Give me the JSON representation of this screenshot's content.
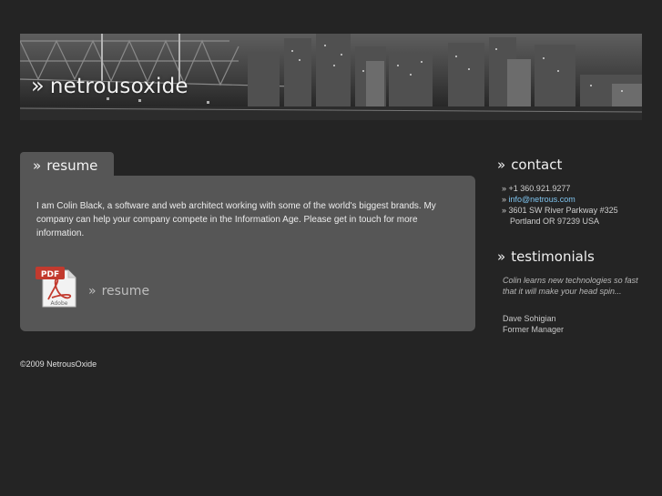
{
  "header": {
    "brand_arrow": "»",
    "brand": "netrousoxide"
  },
  "resume_panel": {
    "tab_arrow": "»",
    "tab_label": "resume",
    "intro": "I am Colin Black, a software and web architect working with some of the world's biggest brands. My company can help your company compete in the Information Age. Please get in touch for more information.",
    "pdf_badge": "PDF",
    "pdf_vendor": "Adobe",
    "download_arrow": "»",
    "download_label": "resume"
  },
  "contact": {
    "arrow": "»",
    "heading": "contact",
    "bullet": "»",
    "phone": "+1 360.921.9277",
    "email": "info@netrous.com",
    "address_line1": "3601 SW River Parkway #325",
    "address_line2": "Portland OR 97239 USA",
    "link_color": "#7fc4ef"
  },
  "testimonials": {
    "arrow": "»",
    "heading": "testimonials",
    "quote": "Colin learns new technologies so fast that it will make your head spin...",
    "author_name": "Dave Sohigian",
    "author_title": "Former Manager"
  },
  "footer": {
    "copyright": "©2009 NetrousOxide"
  }
}
